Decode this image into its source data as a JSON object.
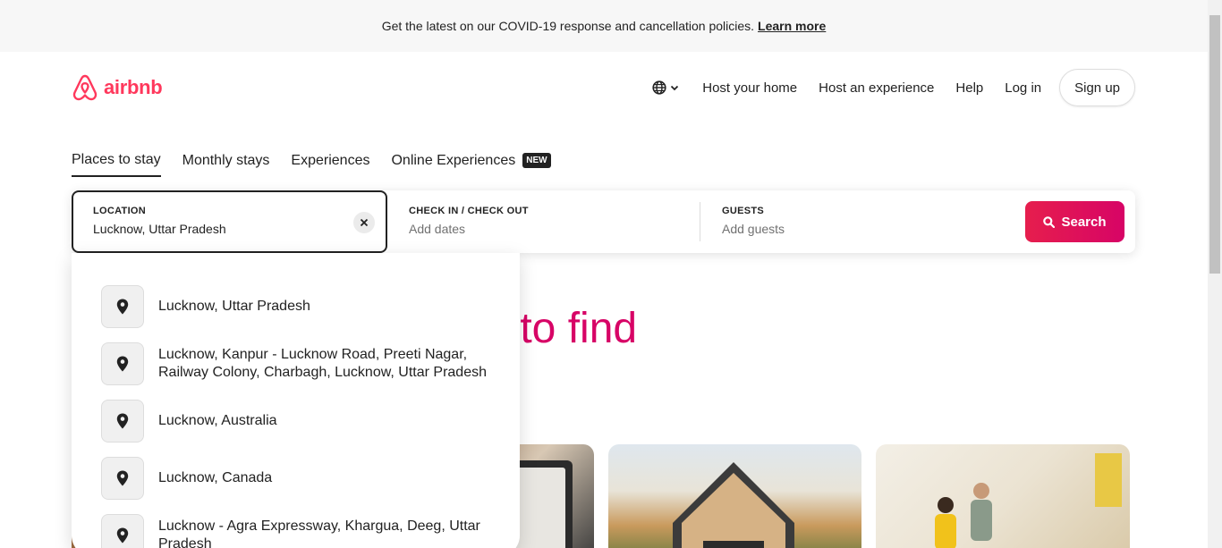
{
  "banner": {
    "message": "Get the latest on our COVID-19 response and cancellation policies.",
    "link": "Learn more"
  },
  "header": {
    "logo_text": "airbnb",
    "nav": {
      "host_home": "Host your home",
      "host_experience": "Host an experience",
      "help": "Help",
      "login": "Log in",
      "signup": "Sign up"
    }
  },
  "tabs": [
    {
      "label": "Places to stay"
    },
    {
      "label": "Monthly stays"
    },
    {
      "label": "Experiences"
    },
    {
      "label": "Online Experiences",
      "badge": "NEW"
    }
  ],
  "search": {
    "location_label": "LOCATION",
    "location_value": "Lucknow, Uttar Pradesh",
    "dates_label": "CHECK IN / CHECK OUT",
    "dates_placeholder": "Add dates",
    "guests_label": "GUESTS",
    "guests_placeholder": "Add guests",
    "button_label": "Search"
  },
  "hero": {
    "visible_text": "r to find"
  },
  "suggestions": [
    {
      "text": "Lucknow, Uttar Pradesh"
    },
    {
      "text": "Lucknow, Kanpur - Lucknow Road, Preeti Nagar, Railway Colony, Charbagh, Lucknow, Uttar Pradesh"
    },
    {
      "text": "Lucknow, Australia"
    },
    {
      "text": "Lucknow, Canada"
    },
    {
      "text": "Lucknow - Agra Expressway, Khargua, Deeg, Uttar Pradesh"
    }
  ],
  "colors": {
    "brand": "#ff385c",
    "search_gradient_start": "#e61e4d",
    "search_gradient_end": "#d70466",
    "hero_text": "#d70466"
  },
  "icons": {
    "globe": "globe-icon",
    "chevron": "chevron-down-icon",
    "clear": "close-icon",
    "search": "search-icon",
    "pin": "location-pin-icon"
  }
}
